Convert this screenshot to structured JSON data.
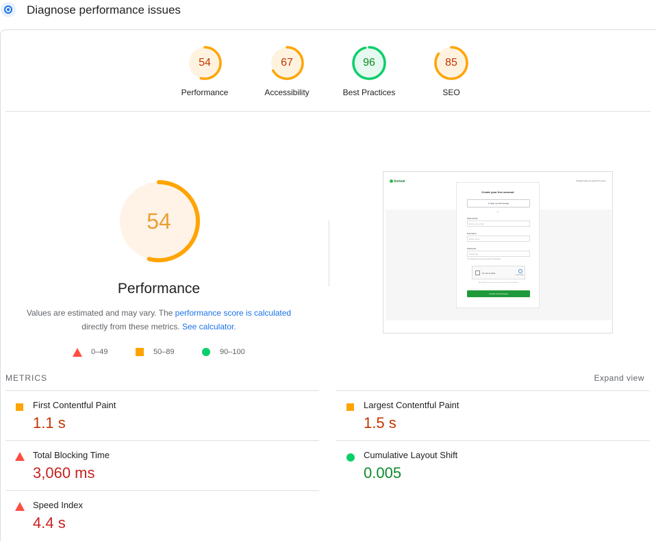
{
  "header": {
    "title": "Diagnose performance issues"
  },
  "categories": [
    {
      "label": "Performance",
      "score": "54",
      "score_value": 54,
      "color": "#ffa400"
    },
    {
      "label": "Accessibility",
      "score": "67",
      "score_value": 67,
      "color": "#ffa400"
    },
    {
      "label": "Best Practices",
      "score": "96",
      "score_value": 96,
      "color": "#0cce6b"
    },
    {
      "label": "SEO",
      "score": "85",
      "score_value": 85,
      "color": "#ffa400"
    }
  ],
  "performance": {
    "score": "54",
    "score_value": 54,
    "title": "Performance",
    "desc_text1": "Values are estimated and may vary. The ",
    "desc_link1": "performance score is calculated",
    "desc_text2": " directly from these metrics. ",
    "desc_link2": "See calculator."
  },
  "legend": {
    "fail": "0–49",
    "average": "50–89",
    "pass": "90–100"
  },
  "metrics_header": "METRICS",
  "expand_label": "Expand view",
  "metrics": [
    {
      "name": "First Contentful Paint",
      "value": "1.1 s",
      "rating": "average"
    },
    {
      "name": "Largest Contentful Paint",
      "value": "1.5 s",
      "rating": "average"
    },
    {
      "name": "Total Blocking Time",
      "value": "3,060 ms",
      "rating": "fail"
    },
    {
      "name": "Cumulative Layout Shift",
      "value": "0.005",
      "rating": "pass"
    },
    {
      "name": "Speed Index",
      "value": "4.4 s",
      "rating": "fail"
    }
  ],
  "screenshot": {
    "brand": "bonsai",
    "top_right": "Already have an account? Log in",
    "heading": "Create your free account",
    "google_btn": "Sign up with Google",
    "or": "or",
    "field1": "Work Email",
    "field1_ph": "Enter your email",
    "field2": "Full Name",
    "field2_ph": "Enter name",
    "field3": "Password",
    "field3_ph": "Password",
    "hint": "Your password must be at least 8 characters",
    "captcha": "I'm not a robot",
    "captcha_brand": "reCAPTCHA",
    "terms": "By clicking this button you agree to our terms and conditions",
    "submit": "Create Free Account"
  },
  "colors": {
    "fail": "#ff4e42",
    "average": "#ffa400",
    "pass": "#0cce6b",
    "link": "#1a73e8"
  }
}
